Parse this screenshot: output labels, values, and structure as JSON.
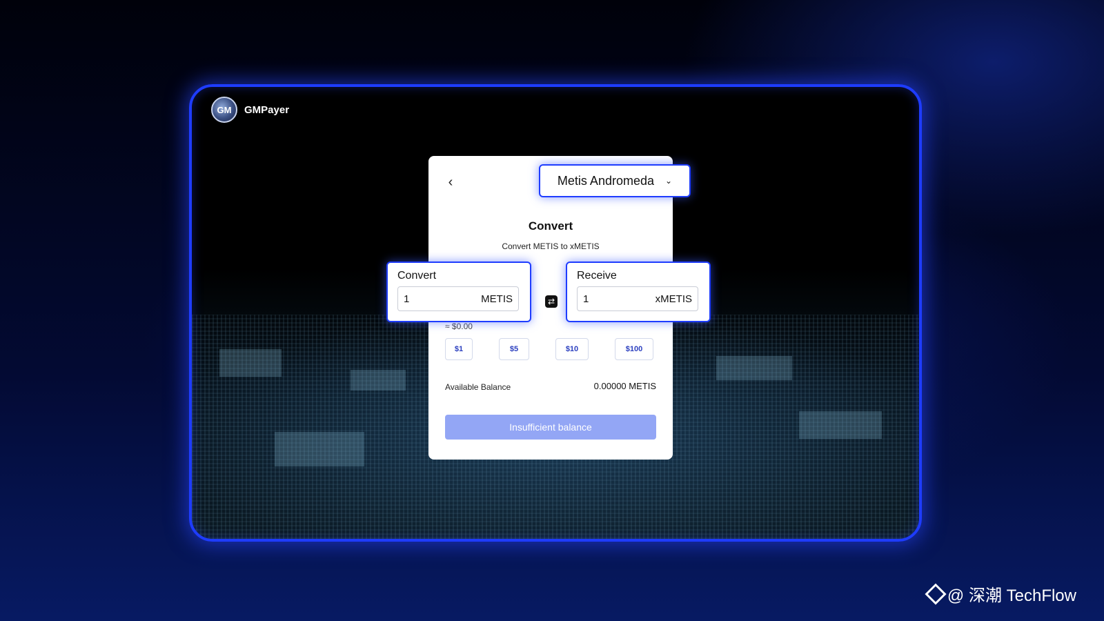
{
  "brand": {
    "name": "GMPayer",
    "logo_text": "GM"
  },
  "card": {
    "back_icon": "chevron-left-icon",
    "network": {
      "selected": "Metis Andromeda",
      "icon": "chevron-down-icon"
    },
    "title": "Convert",
    "subtitle": "Convert METIS to xMETIS",
    "convert": {
      "label": "Convert",
      "value": "1",
      "unit": "METIS"
    },
    "receive": {
      "label": "Receive",
      "value": "1",
      "unit": "xMETIS"
    },
    "swap_icon": "swap-arrows-icon",
    "usd_approx": "≈ $0.00",
    "presets": [
      "$1",
      "$5",
      "$10",
      "$100"
    ],
    "balance": {
      "label": "Available Balance",
      "value": "0.00000 METIS"
    },
    "submit": {
      "label": "Insufficient balance",
      "disabled": true
    }
  },
  "watermark": {
    "text": "@ 深潮 TechFlow",
    "icon": "binance-diamond-icon"
  },
  "colors": {
    "accent": "#1e3cff",
    "button_disabled": "#93a6f5",
    "preset_text": "#2b3fbf"
  }
}
